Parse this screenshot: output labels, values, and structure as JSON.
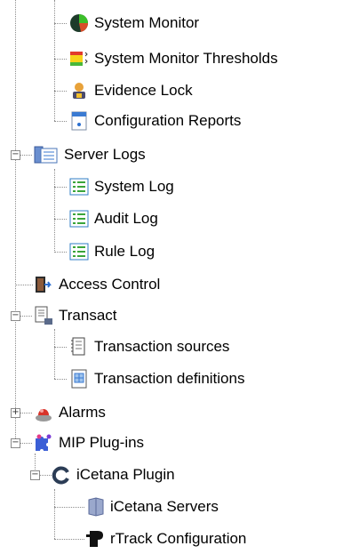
{
  "tree": {
    "items": [
      {
        "label": "System Monitor",
        "icon": "system-monitor-icon"
      },
      {
        "label": "System Monitor Thresholds",
        "icon": "thresholds-icon"
      },
      {
        "label": "Evidence Lock",
        "icon": "evidence-lock-icon"
      },
      {
        "label": "Configuration Reports",
        "icon": "configuration-reports-icon"
      },
      {
        "label": "Server Logs",
        "icon": "server-logs-icon",
        "expander": "−"
      },
      {
        "label": "System Log",
        "icon": "log-icon"
      },
      {
        "label": "Audit Log",
        "icon": "log-icon"
      },
      {
        "label": "Rule Log",
        "icon": "log-icon"
      },
      {
        "label": "Access Control",
        "icon": "access-control-icon"
      },
      {
        "label": "Transact",
        "icon": "transact-icon",
        "expander": "−"
      },
      {
        "label": "Transaction sources",
        "icon": "transaction-sources-icon"
      },
      {
        "label": "Transaction definitions",
        "icon": "transaction-definitions-icon"
      },
      {
        "label": "Alarms",
        "icon": "alarms-icon",
        "expander": "+"
      },
      {
        "label": "MIP Plug-ins",
        "icon": "mip-plugins-icon",
        "expander": "−"
      },
      {
        "label": "iCetana Plugin",
        "icon": "icetana-plugin-icon",
        "expander": "−"
      },
      {
        "label": "iCetana Servers",
        "icon": "icetana-servers-icon"
      },
      {
        "label": "rTrack Configuration",
        "icon": "rtrack-configuration-icon"
      }
    ]
  }
}
